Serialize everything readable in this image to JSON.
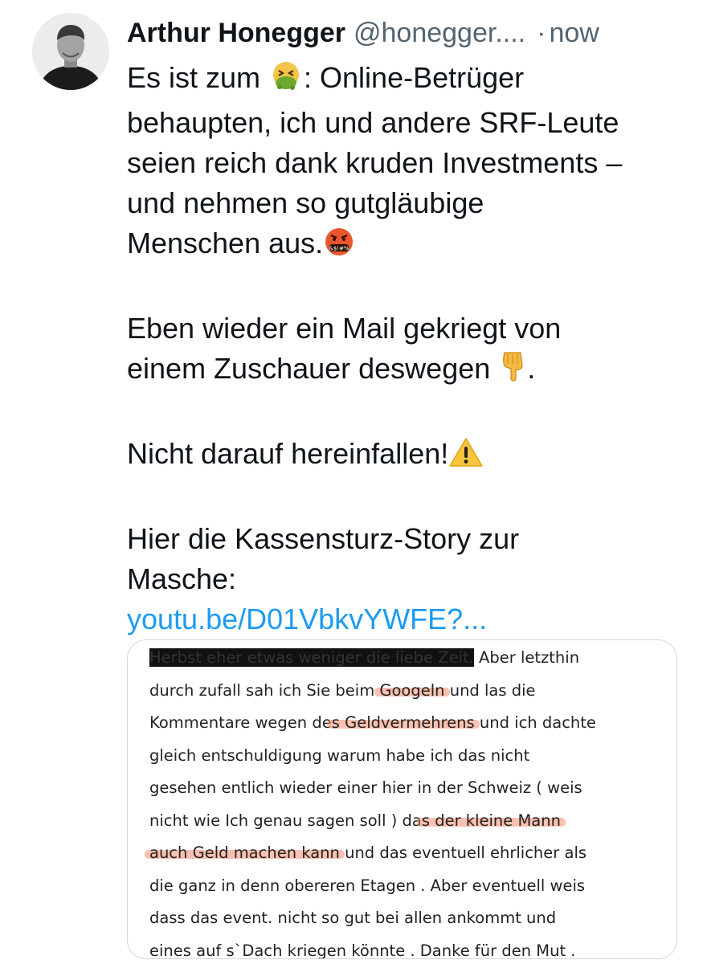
{
  "tweet": {
    "author_name": "Arthur Honegger",
    "handle": "@honegger....",
    "separator": "·",
    "timestamp": "now",
    "line1_pre": "Es ist zum ",
    "line1_post": ": Online-Betrüger",
    "line2": "behaupten, ich und andere SRF-Leute",
    "line3": "seien reich dank kruden Investments –",
    "line4": "und nehmen so gutgläubige",
    "line5": "Menschen aus.",
    "para2_line1": "Eben wieder ein Mail gekriegt von",
    "para2_line2_pre": "einem Zuschauer deswegen ",
    "para2_line2_post": ".",
    "para3": "Nicht darauf hereinfallen!",
    "para4_line1": "Hier die Kassensturz-Story zur",
    "para4_line2": "Masche:",
    "link": "youtu.be/D01VbkvYWFE?...",
    "icons": [
      "vomiting-face-emoji",
      "cursing-face-emoji",
      "backhand-pointing-down-emoji",
      "warning-emoji"
    ]
  },
  "attachment": {
    "l1_redacted": "Herbst eher etwas weniger die liebe Zeit.",
    "l1_rest": " Aber letzthin",
    "l2_pre": "durch zufall sah ich Sie beim ",
    "l2_hl": "Googeln",
    "l2_post": " und las die",
    "l3_pre": "Kommentare wegen de",
    "l3_hl": "s Geldvermehrens",
    "l3_post": " und ich dachte",
    "l4": "gleich entschuldigung warum habe ich das nicht",
    "l5": "gesehen entlich wieder einer hier in der Schweiz ( weis",
    "l6_pre": "nicht wie Ich genau sagen soll ) da",
    "l6_hl": "s der kleine Mann",
    "l7_hl": "auch Geld machen kann",
    "l7_post": " und das eventuell ehrlicher als",
    "l8": "die ganz in denn obereren Etagen . Aber eventuell weis",
    "l9": "dass das event. nicht so gut bei allen ankommt und",
    "l10": "eines auf s`Dach kriegen könnte . Danke für den Mut ."
  }
}
